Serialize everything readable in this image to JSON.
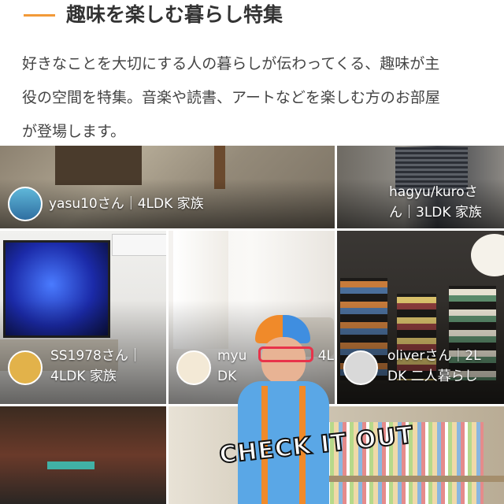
{
  "header": {
    "title": "趣味を楽しむ暮らし特集",
    "description_lines": [
      "好きなことを大切にする人の暮らしが伝わってくる、趣味が主",
      "役の空間を特集。音楽や読書、アートなどを楽しむ方のお部屋",
      "が登場します。"
    ]
  },
  "tiles": [
    {
      "caption_lines": [
        "yasu10さん｜4LDK 家族"
      ]
    },
    {
      "caption_lines": [
        "hagyu/kuroさ",
        "ん｜3LDK 家族"
      ]
    },
    {
      "caption_lines": [
        "SS1978さん｜",
        "4LDK 家族"
      ]
    },
    {
      "caption_lines": [
        "myu",
        "4L",
        "DK"
      ]
    },
    {
      "caption_lines": [
        "oliverさん｜2L",
        "DK 二人暮らし"
      ]
    }
  ],
  "overlay": {
    "text": "CHECK IT OUT"
  },
  "colors": {
    "accent": "#f29a38"
  }
}
